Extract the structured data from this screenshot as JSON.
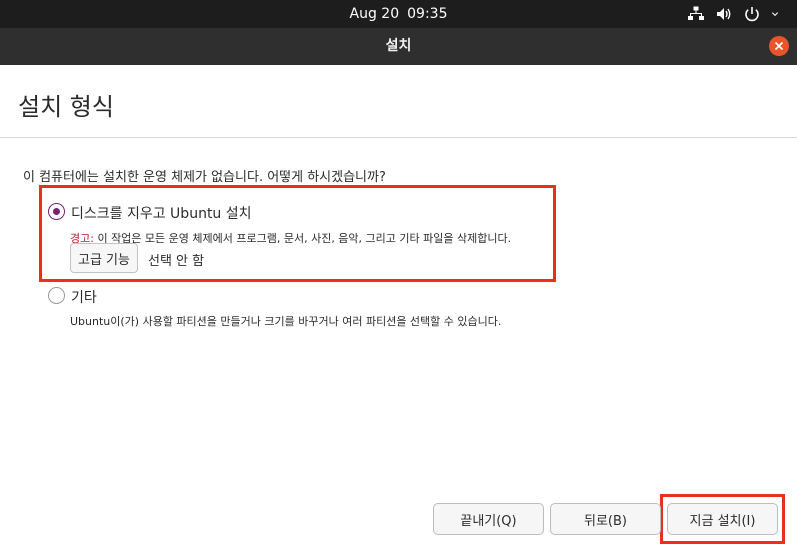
{
  "topbar": {
    "date": "Aug 20",
    "time": "09:35",
    "icons": [
      "network-icon",
      "volume-icon",
      "power-icon",
      "chevron-down-icon"
    ]
  },
  "window": {
    "title": "설치"
  },
  "page": {
    "heading": "설치 형식",
    "question": "이 컴퓨터에는 설치한 운영 체제가 없습니다. 어떻게 하시겠습니까?"
  },
  "options": {
    "erase": {
      "label": "디스크를 지우고 Ubuntu 설치",
      "warning_prefix": "경고:",
      "warning_text": " 이 작업은 모든 운영 체제에서 프로그램, 문서, 사진, 음악, 그리고 기타 파일을 삭제합니다.",
      "selected": true,
      "advanced_button": "고급 기능",
      "advanced_status": "선택 안 함"
    },
    "other": {
      "label": "기타",
      "description": "Ubuntu이(가) 사용할 파티션을 만들거나 크기를 바꾸거나 여러 파티션을 선택할 수 있습니다.",
      "selected": false
    }
  },
  "buttons": {
    "quit": "끝내기(Q)",
    "back": "뒤로(B)",
    "install_now": "지금 설치(I)"
  },
  "colors": {
    "accent": "#77216f",
    "highlight": "#e8301e",
    "close": "#e9542b",
    "warning": "#c7162b"
  }
}
